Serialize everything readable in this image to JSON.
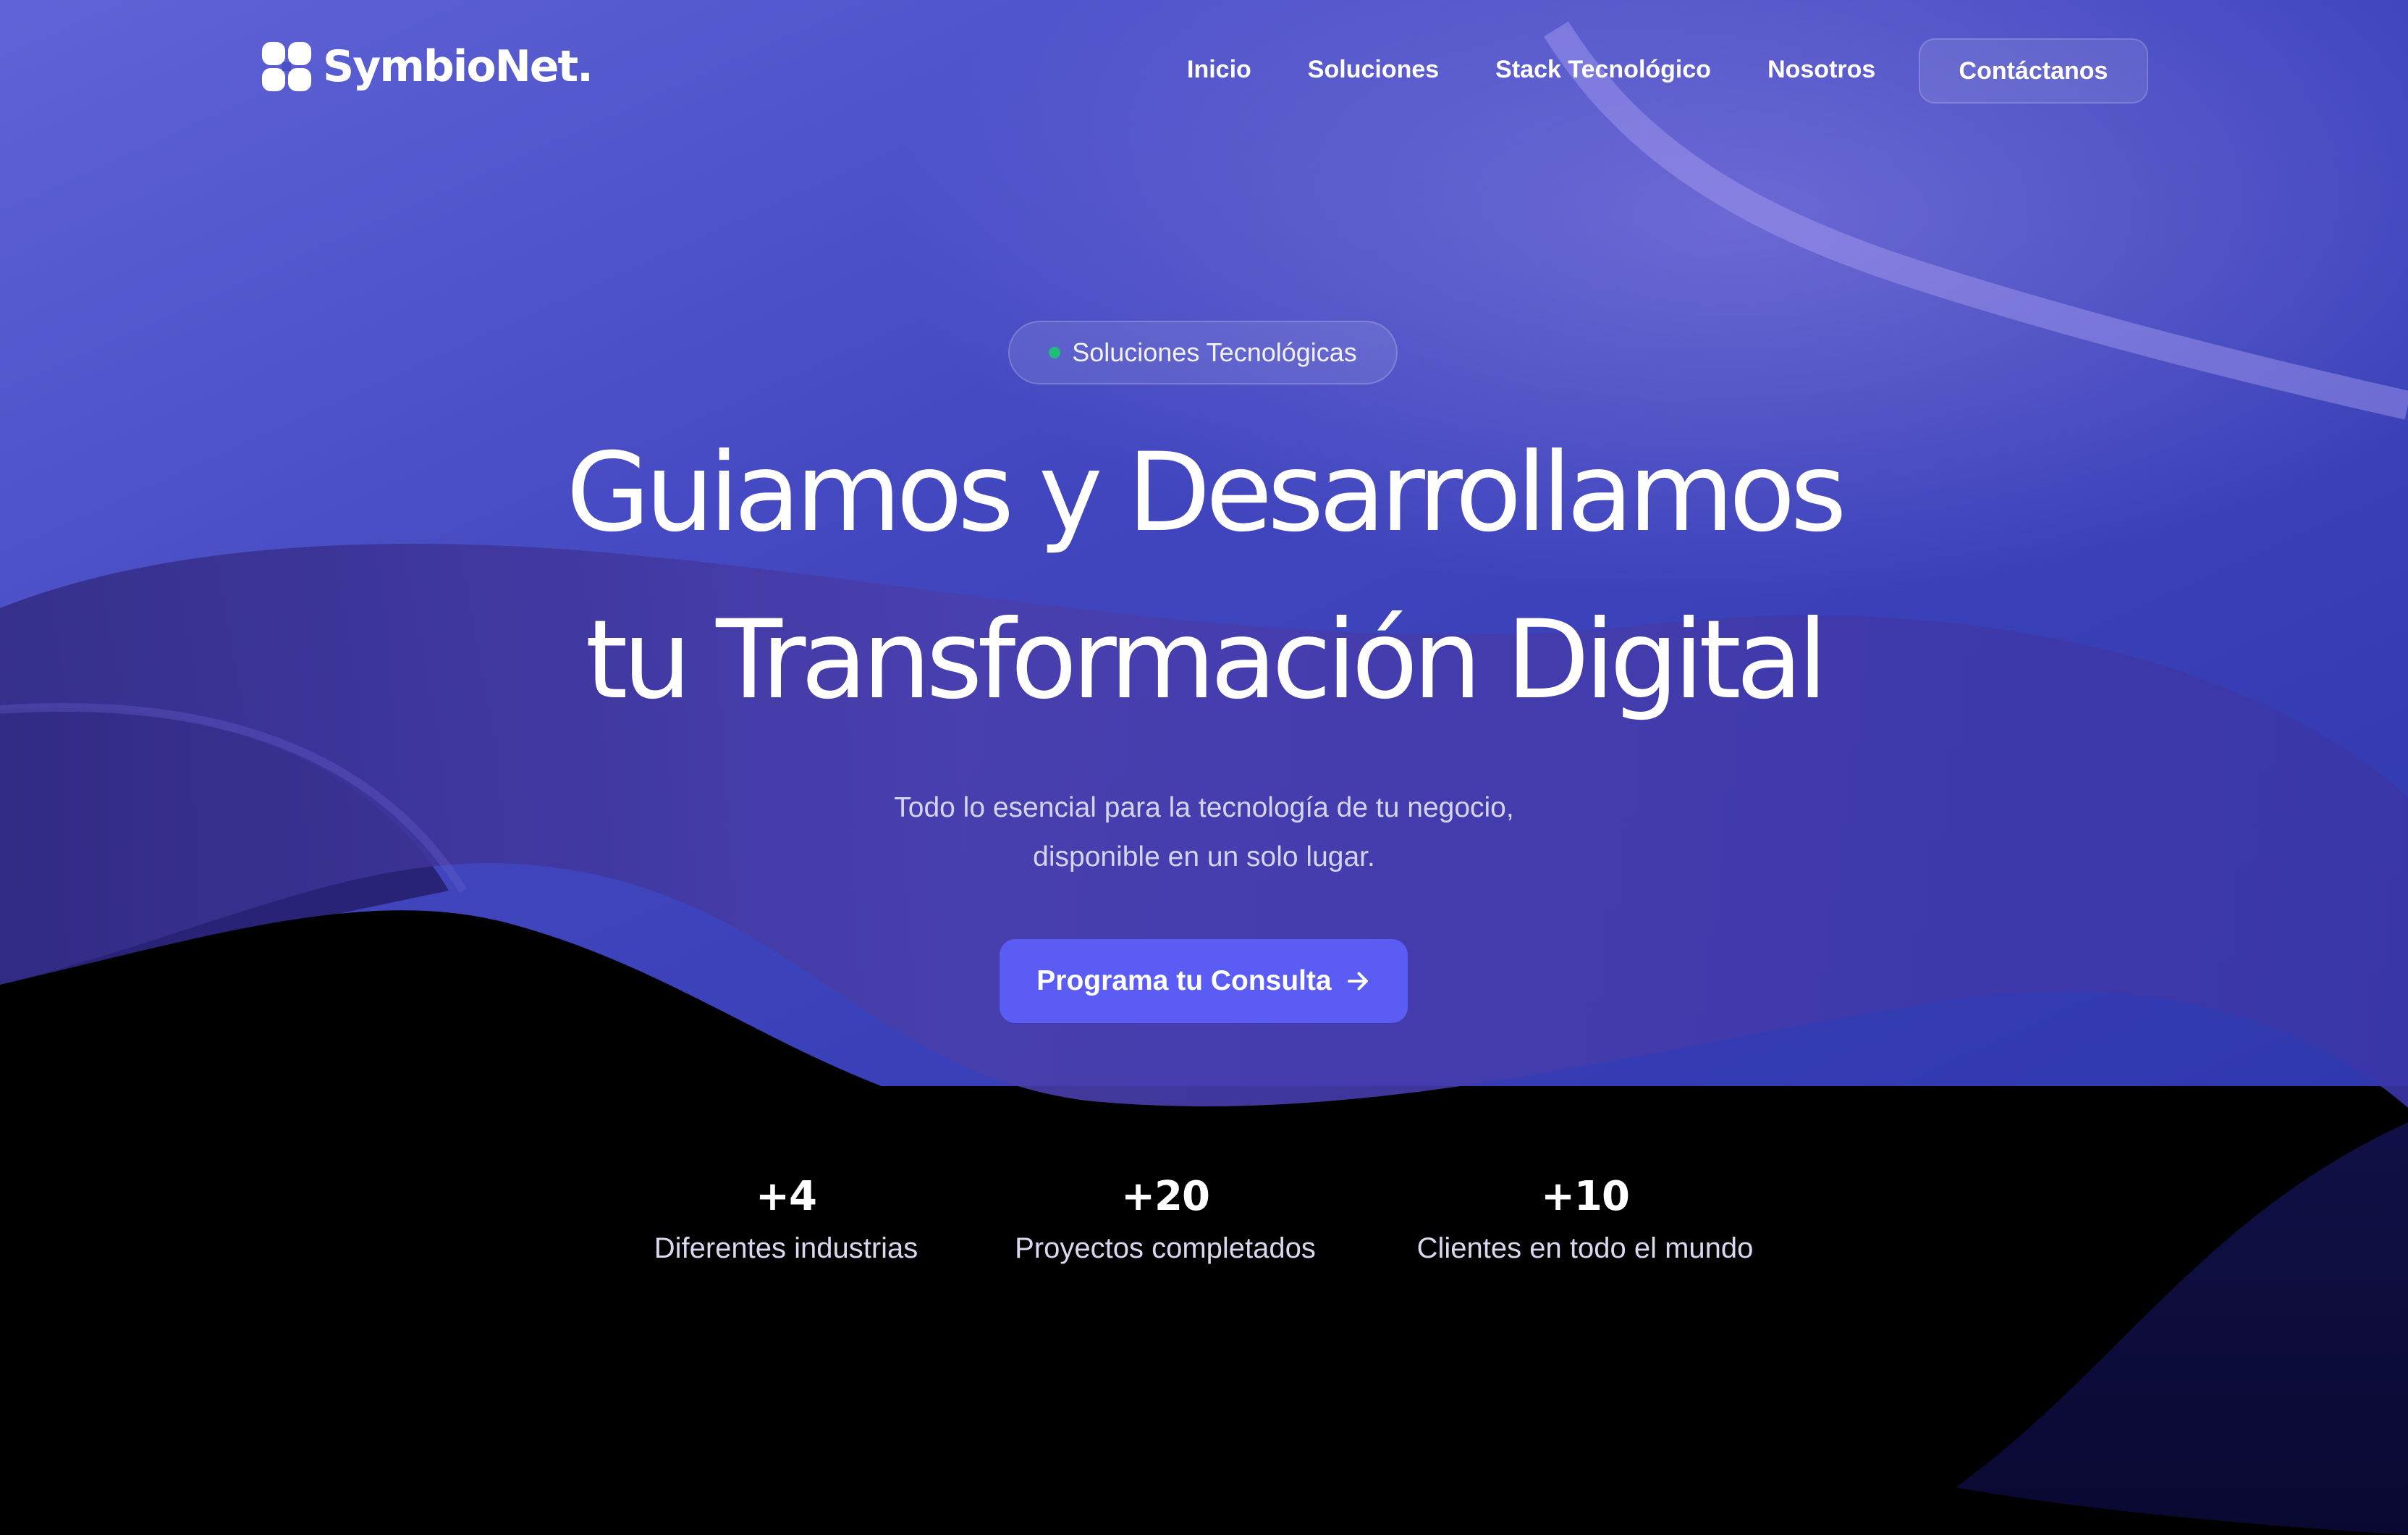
{
  "brand": {
    "name": "SymbioNet.",
    "logo_icon": "flower-grid-icon"
  },
  "nav": {
    "links": [
      "Inicio",
      "Soluciones",
      "Stack Tecnológico",
      "Nosotros"
    ],
    "contact_label": "Contáctanos"
  },
  "hero": {
    "badge": "Soluciones Tecnológicas",
    "title_line1": "Guiamos y Desarrollamos",
    "title_line2": "tu Transformación Digital",
    "subtitle_line1": "Todo lo esencial para la tecnología de tu negocio,",
    "subtitle_line2": "disponible en un solo lugar.",
    "cta_label": "Programa tu Consulta",
    "cta_icon": "arrow-right-icon"
  },
  "stats": [
    {
      "value": "+4",
      "label": "Diferentes industrias"
    },
    {
      "value": "+20",
      "label": "Proyectos completados"
    },
    {
      "value": "+10",
      "label": "Clientes en todo el mundo"
    }
  ],
  "colors": {
    "accent": "#5b5cf3",
    "badge_dot": "#1fbf78",
    "background_top": "#4a4ec4",
    "background_bottom": "#000000"
  }
}
